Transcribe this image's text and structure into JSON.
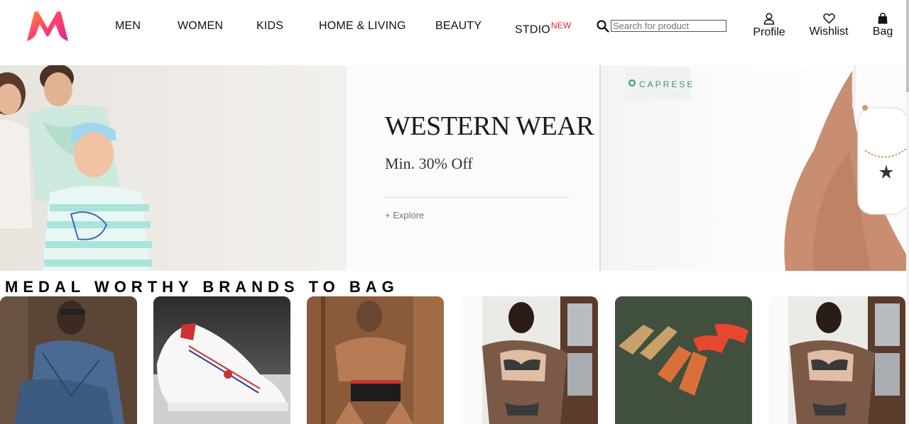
{
  "brand": {
    "logo_icon": "myntra-logo-icon",
    "colors": {
      "logo_start": "#ff3f6c",
      "logo_end": "#f13ab1",
      "new_badge": "#e0252d"
    }
  },
  "nav": {
    "menu": [
      {
        "label": "MEN"
      },
      {
        "label": "WOMEN"
      },
      {
        "label": "KIDS"
      },
      {
        "label": "HOME & LIVING"
      },
      {
        "label": "BEAUTY"
      },
      {
        "label": "STDIO",
        "badge": "NEW"
      }
    ],
    "search": {
      "icon": "search-icon",
      "placeholder": "Search for product",
      "value": ""
    },
    "actions": [
      {
        "label": "Profile",
        "icon": "person-icon"
      },
      {
        "label": "Wishlist",
        "icon": "heart-icon"
      },
      {
        "label": "Bag",
        "icon": "bag-icon"
      }
    ]
  },
  "hero": {
    "title": "WESTERN WEAR",
    "subtitle": "Min. 30% Off",
    "cta": "+ Explore",
    "partner_logo": "CAPRESE"
  },
  "section": {
    "title": "MEDAL WORTHY BRANDS TO BAG"
  },
  "brand_cards": [
    {
      "subject": "denim-model-image"
    },
    {
      "subject": "white-sneaker-image"
    },
    {
      "subject": "innerwear-model-image"
    },
    {
      "subject": "lingerie-model-image"
    },
    {
      "subject": "heels-footwear-image"
    },
    {
      "subject": "lingerie-model-image-2"
    }
  ]
}
